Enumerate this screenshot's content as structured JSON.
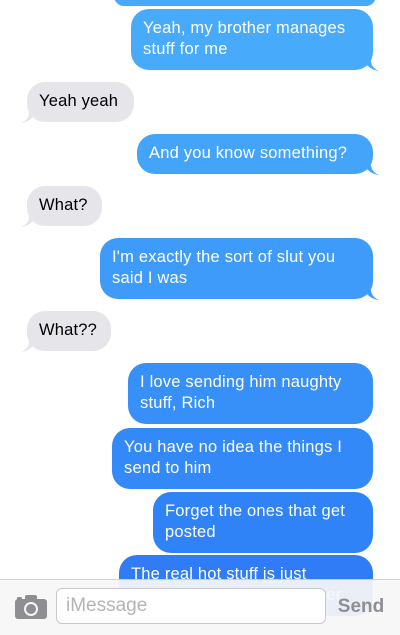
{
  "thread": {
    "messages": [
      {
        "dir": "out",
        "text": "Yeah, my brother manages stuff for me"
      },
      {
        "dir": "in",
        "text": "Yeah yeah"
      },
      {
        "dir": "out",
        "text": "And you know something?"
      },
      {
        "dir": "in",
        "text": "What?"
      },
      {
        "dir": "out",
        "text": "I'm exactly the sort of slut you said I was"
      },
      {
        "dir": "in",
        "text": "What??"
      },
      {
        "dir": "out",
        "text": "I love sending him naughty stuff, Rich"
      },
      {
        "dir": "out",
        "text": "You have no idea the things I send to him"
      },
      {
        "dir": "out",
        "text": "Forget the ones that get posted"
      },
      {
        "dir": "out",
        "text": "The real hot stuff is just between me and my brother"
      }
    ]
  },
  "input": {
    "placeholder": "iMessage",
    "send_label": "Send",
    "camera_icon": "camera-icon"
  },
  "colors": {
    "outgoing_top": "#4fb0fb",
    "outgoing_bottom": "#2f7cf6",
    "incoming": "#e5e5ea",
    "send_disabled": "#8e8e93"
  }
}
